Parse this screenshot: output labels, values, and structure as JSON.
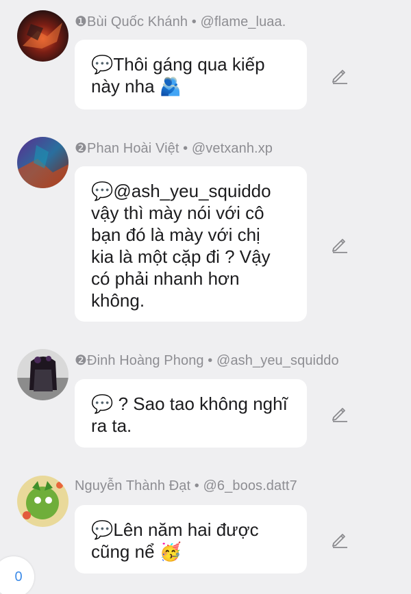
{
  "comments": [
    {
      "header": "❶Bùi Quốc Khánh • @flame_luaa.",
      "text": "💬Thôi gáng qua kiếp\nnày nha 🫂",
      "edit_icon": "pencil-icon"
    },
    {
      "header": "❷Phan Hoài Việt • @vetxanh.xp",
      "text": "💬@ash_yeu_squiddo\nvậy thì mày nói với cô\nbạn đó là mày với chị\nkia là một cặp đi ? Vậy\ncó phải nhanh hơn\nkhông.",
      "edit_icon": "pencil-icon"
    },
    {
      "header": "❷Đinh Hoàng Phong • @ash_yeu_squiddo",
      "text": "💬 ? Sao tao không nghĩ\nra ta.",
      "edit_icon": "pencil-icon"
    },
    {
      "header": "Nguyễn Thành Đạt • @6_boos.datt7",
      "text": "💬Lên năm hai được\ncũng nể 🥳",
      "edit_icon": "pencil-icon"
    }
  ],
  "footer": {
    "comment_count": "0"
  }
}
